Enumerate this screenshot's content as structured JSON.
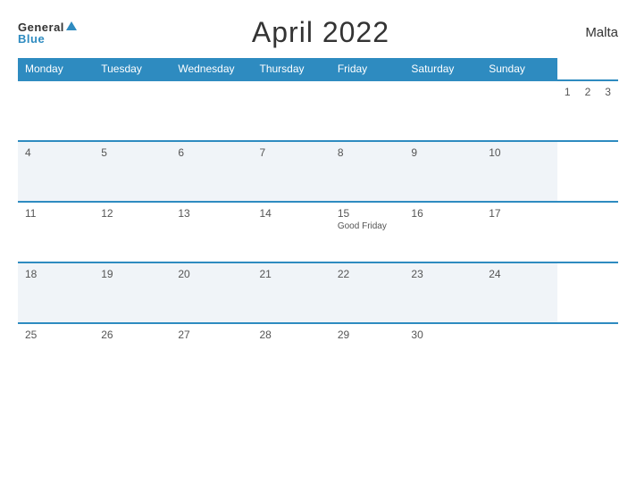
{
  "header": {
    "logo_general": "General",
    "logo_blue": "Blue",
    "title": "April 2022",
    "country": "Malta"
  },
  "calendar": {
    "days_of_week": [
      "Monday",
      "Tuesday",
      "Wednesday",
      "Thursday",
      "Friday",
      "Saturday",
      "Sunday"
    ],
    "weeks": [
      [
        {
          "day": "",
          "event": ""
        },
        {
          "day": "",
          "event": ""
        },
        {
          "day": "",
          "event": ""
        },
        {
          "day": "1",
          "event": ""
        },
        {
          "day": "2",
          "event": ""
        },
        {
          "day": "3",
          "event": ""
        }
      ],
      [
        {
          "day": "4",
          "event": ""
        },
        {
          "day": "5",
          "event": ""
        },
        {
          "day": "6",
          "event": ""
        },
        {
          "day": "7",
          "event": ""
        },
        {
          "day": "8",
          "event": ""
        },
        {
          "day": "9",
          "event": ""
        },
        {
          "day": "10",
          "event": ""
        }
      ],
      [
        {
          "day": "11",
          "event": ""
        },
        {
          "day": "12",
          "event": ""
        },
        {
          "day": "13",
          "event": ""
        },
        {
          "day": "14",
          "event": ""
        },
        {
          "day": "15",
          "event": "Good Friday"
        },
        {
          "day": "16",
          "event": ""
        },
        {
          "day": "17",
          "event": ""
        }
      ],
      [
        {
          "day": "18",
          "event": ""
        },
        {
          "day": "19",
          "event": ""
        },
        {
          "day": "20",
          "event": ""
        },
        {
          "day": "21",
          "event": ""
        },
        {
          "day": "22",
          "event": ""
        },
        {
          "day": "23",
          "event": ""
        },
        {
          "day": "24",
          "event": ""
        }
      ],
      [
        {
          "day": "25",
          "event": ""
        },
        {
          "day": "26",
          "event": ""
        },
        {
          "day": "27",
          "event": ""
        },
        {
          "day": "28",
          "event": ""
        },
        {
          "day": "29",
          "event": ""
        },
        {
          "day": "30",
          "event": ""
        },
        {
          "day": "",
          "event": ""
        }
      ]
    ]
  }
}
